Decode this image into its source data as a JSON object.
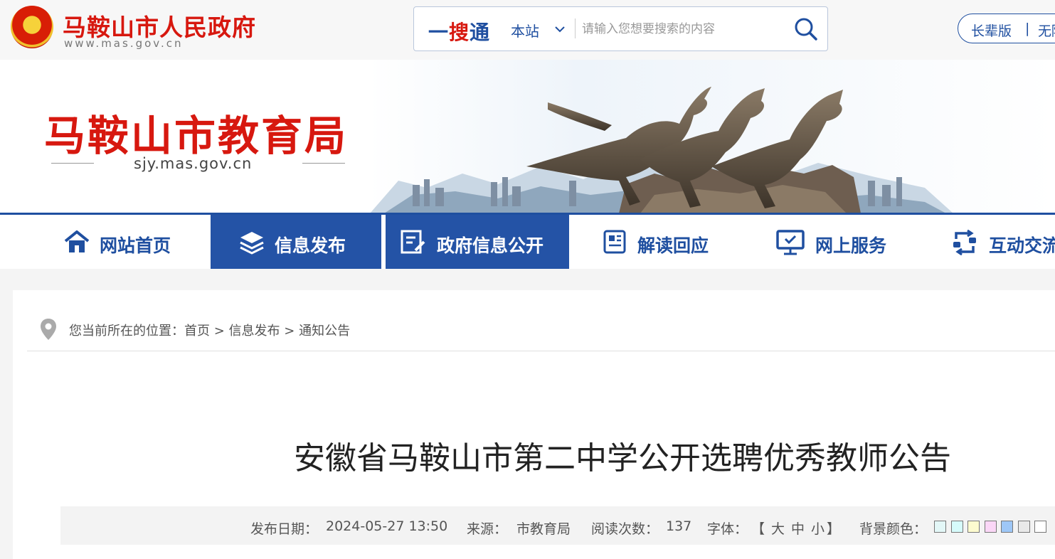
{
  "header": {
    "site_name": "马鞍山市人民政府",
    "site_url": "www.mas.gov.cn"
  },
  "search": {
    "logo_part1": "一",
    "logo_part2": "搜",
    "logo_part3": "通",
    "scope": "本站",
    "placeholder": "请输入您想要搜索的内容"
  },
  "elder_toggle": {
    "elder_label": "长辈版",
    "separator": "|",
    "accessible_label": "无障碍"
  },
  "banner": {
    "title": "马鞍山市教育局",
    "url": "sjy.mas.gov.cn"
  },
  "nav": {
    "items": [
      {
        "label": "网站首页",
        "icon": "home-icon"
      },
      {
        "label": "信息发布",
        "icon": "layers-icon"
      },
      {
        "label": "政府信息公开",
        "icon": "document-icon"
      },
      {
        "label": "解读回应",
        "icon": "newspaper-icon"
      },
      {
        "label": "网上服务",
        "icon": "monitor-icon"
      },
      {
        "label": "互动交流",
        "icon": "exchange-icon"
      }
    ]
  },
  "breadcrumb": {
    "prefix": "您当前所在的位置：",
    "items": [
      "首页",
      "信息发布",
      "通知公告"
    ],
    "separator": ">"
  },
  "article": {
    "title": "安徽省马鞍山市第二中学公开选聘优秀教师公告",
    "date_label": "发布日期：",
    "date_value": "2024-05-27 13:50",
    "source_label": "来源：",
    "source_value": "市教育局",
    "views_label": "阅读次数：",
    "views_value": "137",
    "font_label": "字体：",
    "font_open": "【",
    "font_large": "大",
    "font_medium": "中",
    "font_small": "小",
    "font_close": "】",
    "bg_label": "背景颜色："
  },
  "colors": {
    "brand_red": "#d7180f",
    "brand_blue": "#1f4fa0",
    "nav_active": "#2453a6",
    "swatches": [
      "#e3f7f7",
      "#d6fbfb",
      "#fdfbcf",
      "#fbd7f7",
      "#9ec7f7",
      "#e9e9e9",
      "#ffffff"
    ]
  }
}
